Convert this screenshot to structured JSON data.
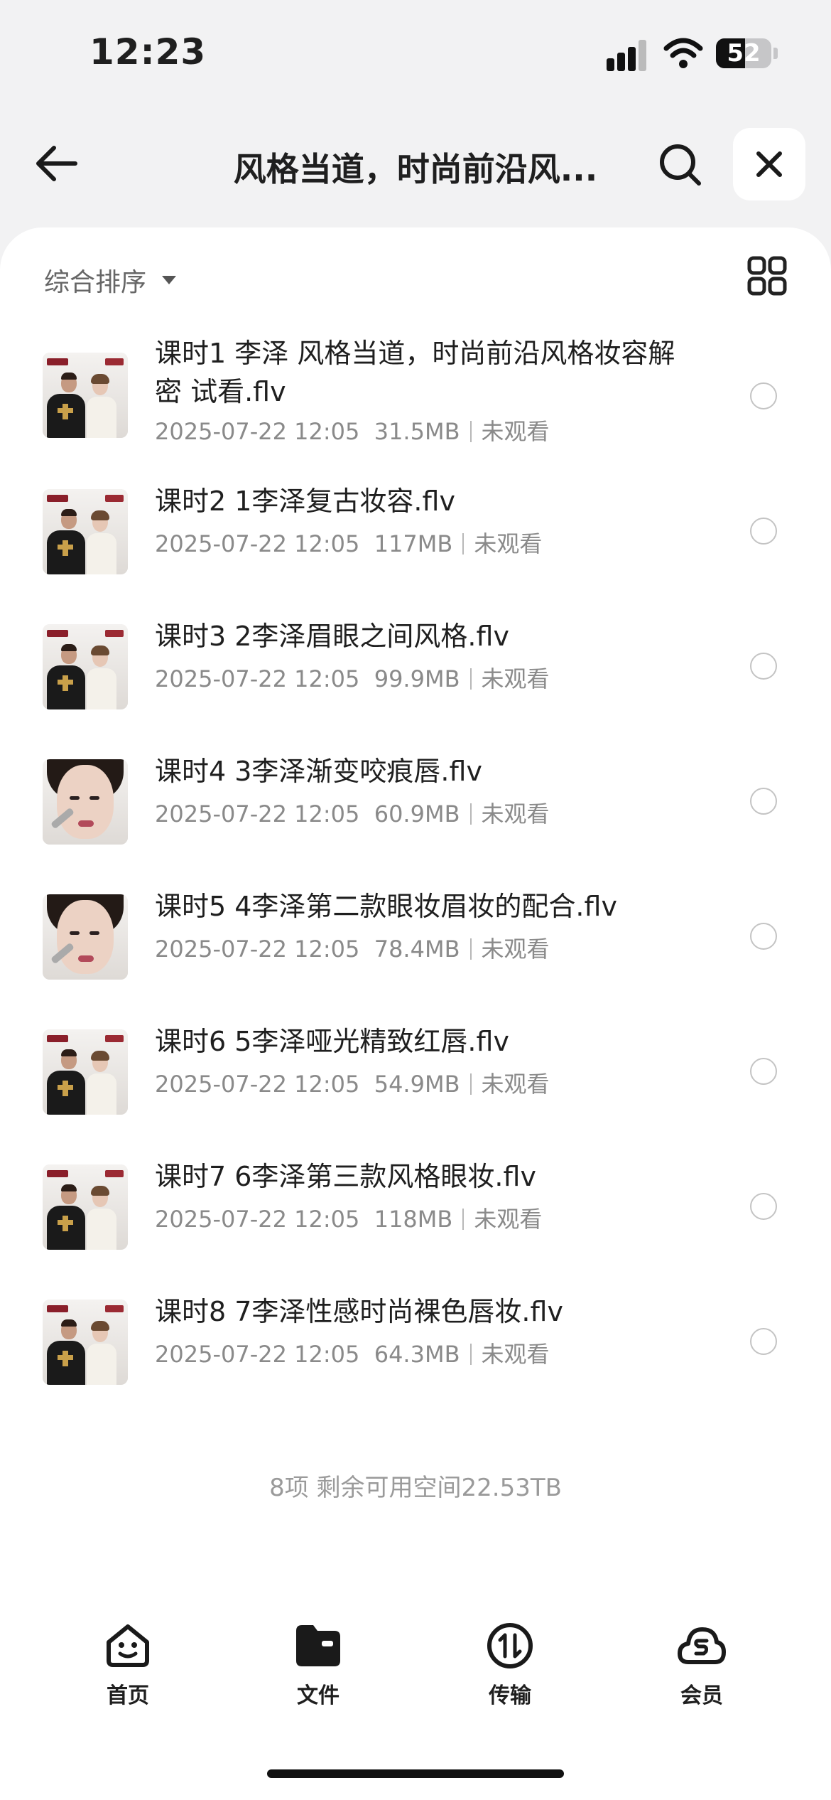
{
  "status_bar": {
    "time": "12:23",
    "battery": "52",
    "battery_level": 0.52
  },
  "header": {
    "title": "风格当道，时尚前沿风...",
    "back_icon": "arrow-left-icon",
    "search_icon": "search-icon",
    "close_icon": "close-icon"
  },
  "toolbar": {
    "sort_label": "综合排序",
    "view_icon": "grid-view-icon"
  },
  "files": [
    {
      "name": "课时1 李泽 风格当道，时尚前沿风格妆容解密 试看.flv",
      "date": "2025-07-22 12:05",
      "size": "31.5MB",
      "status": "未观看",
      "thumb": "duo"
    },
    {
      "name": "课时2 1李泽复古妆容.flv",
      "date": "2025-07-22 12:05",
      "size": "117MB",
      "status": "未观看",
      "thumb": "duo"
    },
    {
      "name": "课时3 2李泽眉眼之间风格.flv",
      "date": "2025-07-22 12:05",
      "size": "99.9MB",
      "status": "未观看",
      "thumb": "duo"
    },
    {
      "name": "课时4 3李泽渐变咬痕唇.flv",
      "date": "2025-07-22 12:05",
      "size": "60.9MB",
      "status": "未观看",
      "thumb": "face"
    },
    {
      "name": "课时5 4李泽第二款眼妆眉妆的配合.flv",
      "date": "2025-07-22 12:05",
      "size": "78.4MB",
      "status": "未观看",
      "thumb": "face"
    },
    {
      "name": "课时6 5李泽哑光精致红唇.flv",
      "date": "2025-07-22 12:05",
      "size": "54.9MB",
      "status": "未观看",
      "thumb": "duo"
    },
    {
      "name": "课时7 6李泽第三款风格眼妆.flv",
      "date": "2025-07-22 12:05",
      "size": "118MB",
      "status": "未观看",
      "thumb": "duo"
    },
    {
      "name": "课时8 7李泽性感时尚裸色唇妆.flv",
      "date": "2025-07-22 12:05",
      "size": "64.3MB",
      "status": "未观看",
      "thumb": "duo"
    }
  ],
  "footer": {
    "summary": "8项 剩余可用空间22.53TB"
  },
  "tabbar": [
    {
      "label": "首页",
      "icon": "home-face-icon"
    },
    {
      "label": "文件",
      "icon": "folder-icon"
    },
    {
      "label": "传输",
      "icon": "transfer-icon"
    },
    {
      "label": "会员",
      "icon": "member-cloud-icon"
    }
  ]
}
